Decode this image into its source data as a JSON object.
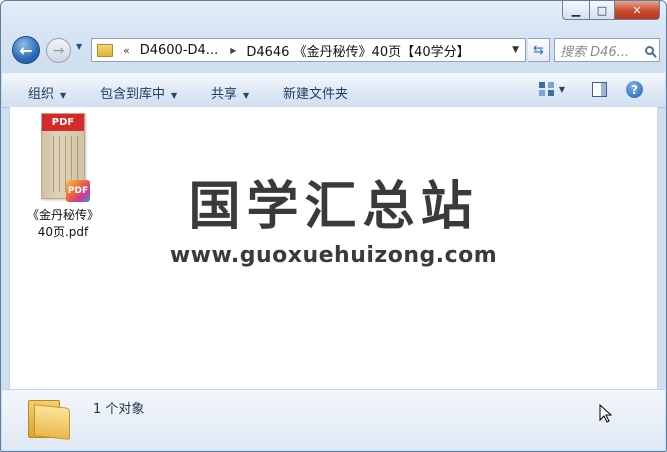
{
  "window": {
    "caption": {
      "minimize": "▁",
      "maximize": "□",
      "close": "✕"
    }
  },
  "nav": {
    "back_icon": "back-arrow-icon",
    "forward_icon": "forward-arrow-icon",
    "address": {
      "overflow": "«",
      "segments": [
        "D4600-D4...",
        "D4646 《金丹秘传》40页【40学分】"
      ]
    },
    "search_placeholder": "搜索 D46..."
  },
  "toolbar": {
    "organize": "组织",
    "include_in_library": "包含到库中",
    "share": "共享",
    "new_folder": "新建文件夹",
    "help": "?"
  },
  "files": [
    {
      "name": "《金丹秘传》40页.pdf",
      "type_badge": "PDF"
    }
  ],
  "watermark": {
    "title": "国学汇总站",
    "url": "www.guoxuehuizong.com"
  },
  "details": {
    "status": "1 个对象"
  }
}
